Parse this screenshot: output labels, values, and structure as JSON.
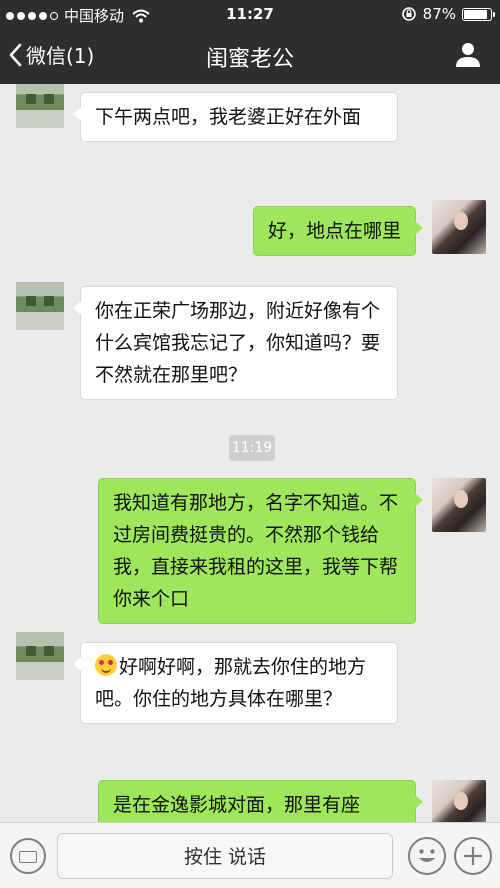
{
  "status_bar": {
    "carrier": "中国移动",
    "time": "11:27",
    "battery": "87%",
    "battery_level": 0.87
  },
  "nav": {
    "back_label": "微信(1)",
    "title": "闺蜜老公"
  },
  "messages": [
    {
      "side": "in",
      "text": "下午两点吧，我老婆正好在外面"
    },
    {
      "side": "out",
      "text": "好，地点在哪里"
    },
    {
      "side": "in",
      "text": "你在正荣广场那边，附近好像有个什么宾馆我忘记了，你知道吗？要不然就在那里吧？"
    },
    {
      "side": "out",
      "text": "我知道有那地方，名字不知道。不过房间费挺贵的。不然那个钱给我，直接来我租的这里，我等下帮你来个口"
    },
    {
      "side": "in",
      "emoji": "heart-eyes-emoji",
      "text": "好啊好啊，那就去你住的地方吧。你住的地方具体在哪里？"
    },
    {
      "side": "out",
      "text": "是在金逸影城对面，那里有座"
    }
  ],
  "timestamp": "11:19",
  "input_bar": {
    "hold_to_talk": "按住 说话"
  }
}
